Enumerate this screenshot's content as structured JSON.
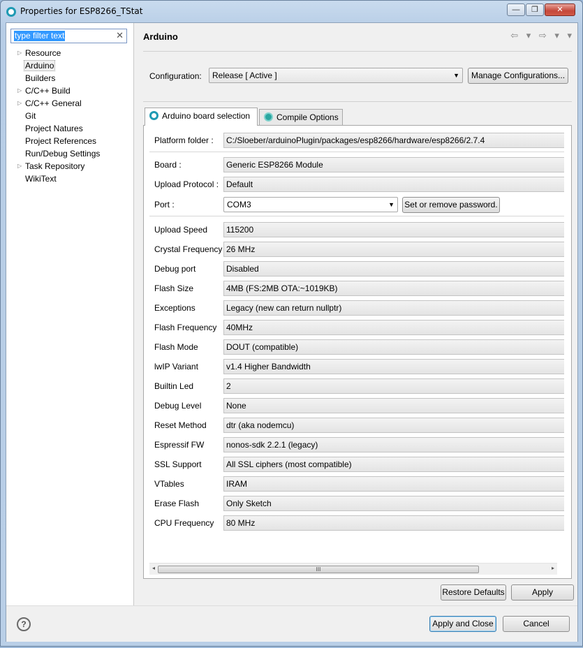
{
  "window": {
    "title": "Properties for ESP8266_TStat",
    "controls": {
      "minimize": "—",
      "maximize": "❐",
      "close": "✕"
    }
  },
  "filter": {
    "placeholder": "type filter text",
    "clear_icon": "✕"
  },
  "tree": {
    "items": [
      {
        "label": "Resource",
        "expandable": true
      },
      {
        "label": "Arduino",
        "expandable": false,
        "selected": true
      },
      {
        "label": "Builders",
        "expandable": false
      },
      {
        "label": "C/C++ Build",
        "expandable": true
      },
      {
        "label": "C/C++ General",
        "expandable": true
      },
      {
        "label": "Git",
        "expandable": false
      },
      {
        "label": "Project Natures",
        "expandable": false
      },
      {
        "label": "Project References",
        "expandable": false
      },
      {
        "label": "Run/Debug Settings",
        "expandable": false
      },
      {
        "label": "Task Repository",
        "expandable": true
      },
      {
        "label": "WikiText",
        "expandable": false
      }
    ]
  },
  "page": {
    "title": "Arduino",
    "nav": "⇦ ▾ ⇨ ▾ ▾"
  },
  "configuration": {
    "label": "Configuration:",
    "value": "Release  [ Active ]",
    "manage_label": "Manage Configurations..."
  },
  "tabs": [
    {
      "label": "Arduino board selection",
      "icon": "arduino-gear-icon",
      "active": true
    },
    {
      "label": "Compile Options",
      "icon": "compile-icon",
      "active": false
    }
  ],
  "board": {
    "platform_folder": {
      "label": "Platform folder :",
      "value": "C:/Sloeber/arduinoPlugin/packages/esp8266/hardware/esp8266/2.7.4"
    },
    "board": {
      "label": "Board :",
      "value": "Generic ESP8266 Module"
    },
    "upload_protocol": {
      "label": "Upload Protocol :",
      "value": "Default"
    },
    "port": {
      "label": "Port :",
      "value": "COM3",
      "password_button": "Set or remove password."
    },
    "options": [
      {
        "label": "Upload Speed",
        "value": "115200"
      },
      {
        "label": "Crystal Frequency",
        "value": "26 MHz"
      },
      {
        "label": "Debug port",
        "value": "Disabled"
      },
      {
        "label": "Flash Size",
        "value": "4MB (FS:2MB OTA:~1019KB)"
      },
      {
        "label": "Exceptions",
        "value": "Legacy (new can return nullptr)"
      },
      {
        "label": "Flash Frequency",
        "value": "40MHz"
      },
      {
        "label": "Flash Mode",
        "value": "DOUT (compatible)"
      },
      {
        "label": "lwIP Variant",
        "value": "v1.4 Higher Bandwidth"
      },
      {
        "label": "Builtin Led",
        "value": "2"
      },
      {
        "label": "Debug Level",
        "value": "None"
      },
      {
        "label": "Reset Method",
        "value": "dtr (aka nodemcu)"
      },
      {
        "label": "Espressif FW",
        "value": "nonos-sdk 2.2.1 (legacy)"
      },
      {
        "label": "SSL Support",
        "value": "All SSL ciphers (most compatible)"
      },
      {
        "label": "VTables",
        "value": "IRAM"
      },
      {
        "label": "Erase Flash",
        "value": "Only Sketch"
      },
      {
        "label": "CPU Frequency",
        "value": "80 MHz"
      }
    ]
  },
  "scrollbar": {
    "thumb_grip": "III",
    "left_arrow": "◂",
    "right_arrow": "▸"
  },
  "buttons": {
    "restore_defaults": "Restore Defaults",
    "apply": "Apply",
    "apply_and_close": "Apply and Close",
    "cancel": "Cancel",
    "help": "?"
  },
  "colors": {
    "title_gradient": "#c9dbee",
    "selection": "#3399ff",
    "arduino_icon": "#1f9ab3",
    "compile_icon": "#2aa6a0"
  }
}
